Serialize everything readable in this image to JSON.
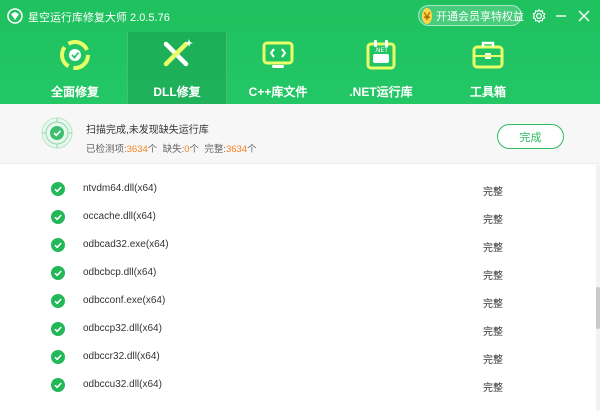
{
  "app": {
    "title": "星空运行库修复大师 2.0.5.76"
  },
  "vip": {
    "badge": "￥",
    "label": "开通会员享特权益"
  },
  "nav": {
    "items": [
      {
        "label": "全面修复",
        "icon": "shield-refresh-icon"
      },
      {
        "label": "DLL修复",
        "icon": "dll-wrench-icon"
      },
      {
        "label": "C++库文件",
        "icon": "code-monitor-icon"
      },
      {
        "label": ".NET运行库",
        "icon": "net-calendar-icon"
      },
      {
        "label": "工具箱",
        "icon": "toolbox-icon"
      }
    ],
    "active_index": 1
  },
  "status": {
    "title": "扫描完成,未发现缺失运行库",
    "checked_label": "已检测项:",
    "checked_value": "3634",
    "checked_unit": "个",
    "missing_label": "缺失:",
    "missing_value": "0",
    "missing_unit": "个",
    "complete_label": "完整:",
    "complete_value": "3634",
    "complete_unit": "个",
    "done_button": "完成"
  },
  "files": [
    {
      "name": "ntvdm64.dll(x64)",
      "status": "完整"
    },
    {
      "name": "occache.dll(x64)",
      "status": "完整"
    },
    {
      "name": "odbcad32.exe(x64)",
      "status": "完整"
    },
    {
      "name": "odbcbcp.dll(x64)",
      "status": "完整"
    },
    {
      "name": "odbcconf.exe(x64)",
      "status": "完整"
    },
    {
      "name": "odbccp32.dll(x64)",
      "status": "完整"
    },
    {
      "name": "odbccr32.dll(x64)",
      "status": "完整"
    },
    {
      "name": "odbccu32.dll(x64)",
      "status": "完整"
    }
  ],
  "colors": {
    "header_green": "#23c765",
    "check_green": "#22b858",
    "accent_orange": "#f58220"
  }
}
